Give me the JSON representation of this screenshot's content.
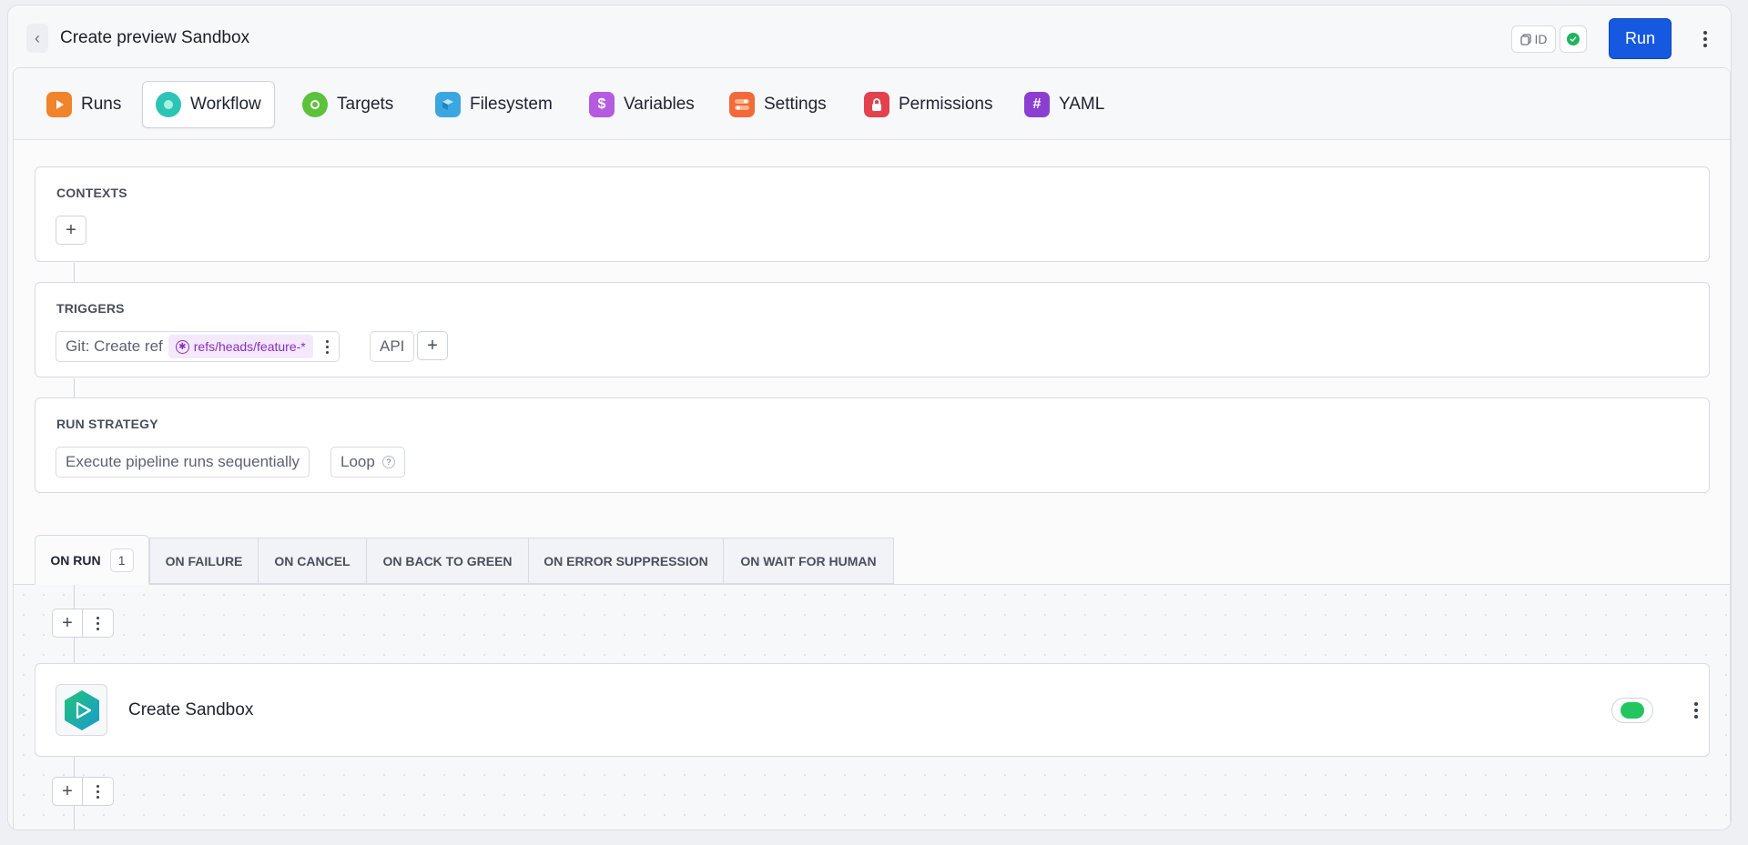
{
  "header": {
    "title": "Create preview Sandbox",
    "id_label": "ID",
    "run_label": "Run"
  },
  "tabs": [
    {
      "label": "Runs",
      "icon": "runs-icon",
      "color": "#f0832b"
    },
    {
      "label": "Workflow",
      "icon": "workflow-icon",
      "color": "#2cc4b4"
    },
    {
      "label": "Targets",
      "icon": "targets-icon",
      "color": "#5cc23b"
    },
    {
      "label": "Filesystem",
      "icon": "filesystem-icon",
      "color": "#3aa7e0"
    },
    {
      "label": "Variables",
      "icon": "variables-icon",
      "color": "#b45be0"
    },
    {
      "label": "Settings",
      "icon": "settings-icon",
      "color": "#f26a3b"
    },
    {
      "label": "Permissions",
      "icon": "lock-icon",
      "color": "#e2424d"
    },
    {
      "label": "YAML",
      "icon": "hash-icon",
      "color": "#8b3fd0"
    }
  ],
  "active_tab": "Workflow",
  "contexts": {
    "title": "CONTEXTS"
  },
  "triggers": {
    "title": "TRIGGERS",
    "items": [
      {
        "label": "Git: Create ref",
        "ref": "refs/heads/feature-*"
      },
      {
        "label": "API"
      }
    ]
  },
  "run_strategy": {
    "title": "RUN STRATEGY",
    "mode": "Execute pipeline runs sequentially",
    "loop_label": "Loop",
    "help": "?"
  },
  "events": {
    "tabs": [
      {
        "label": "ON RUN",
        "count": "1"
      },
      {
        "label": "ON FAILURE"
      },
      {
        "label": "ON CANCEL"
      },
      {
        "label": "ON BACK TO GREEN"
      },
      {
        "label": "ON ERROR SUPPRESSION"
      },
      {
        "label": "ON WAIT FOR HUMAN"
      }
    ],
    "active": "ON RUN"
  },
  "actions": [
    {
      "name": "Create Sandbox",
      "enabled": true,
      "icon": "sandbox-play-icon",
      "color": "#1fb57a"
    }
  ],
  "colors": {
    "accent": "#1559e0",
    "success": "#22b35e",
    "ref_badge_text": "#8a2dbd"
  }
}
